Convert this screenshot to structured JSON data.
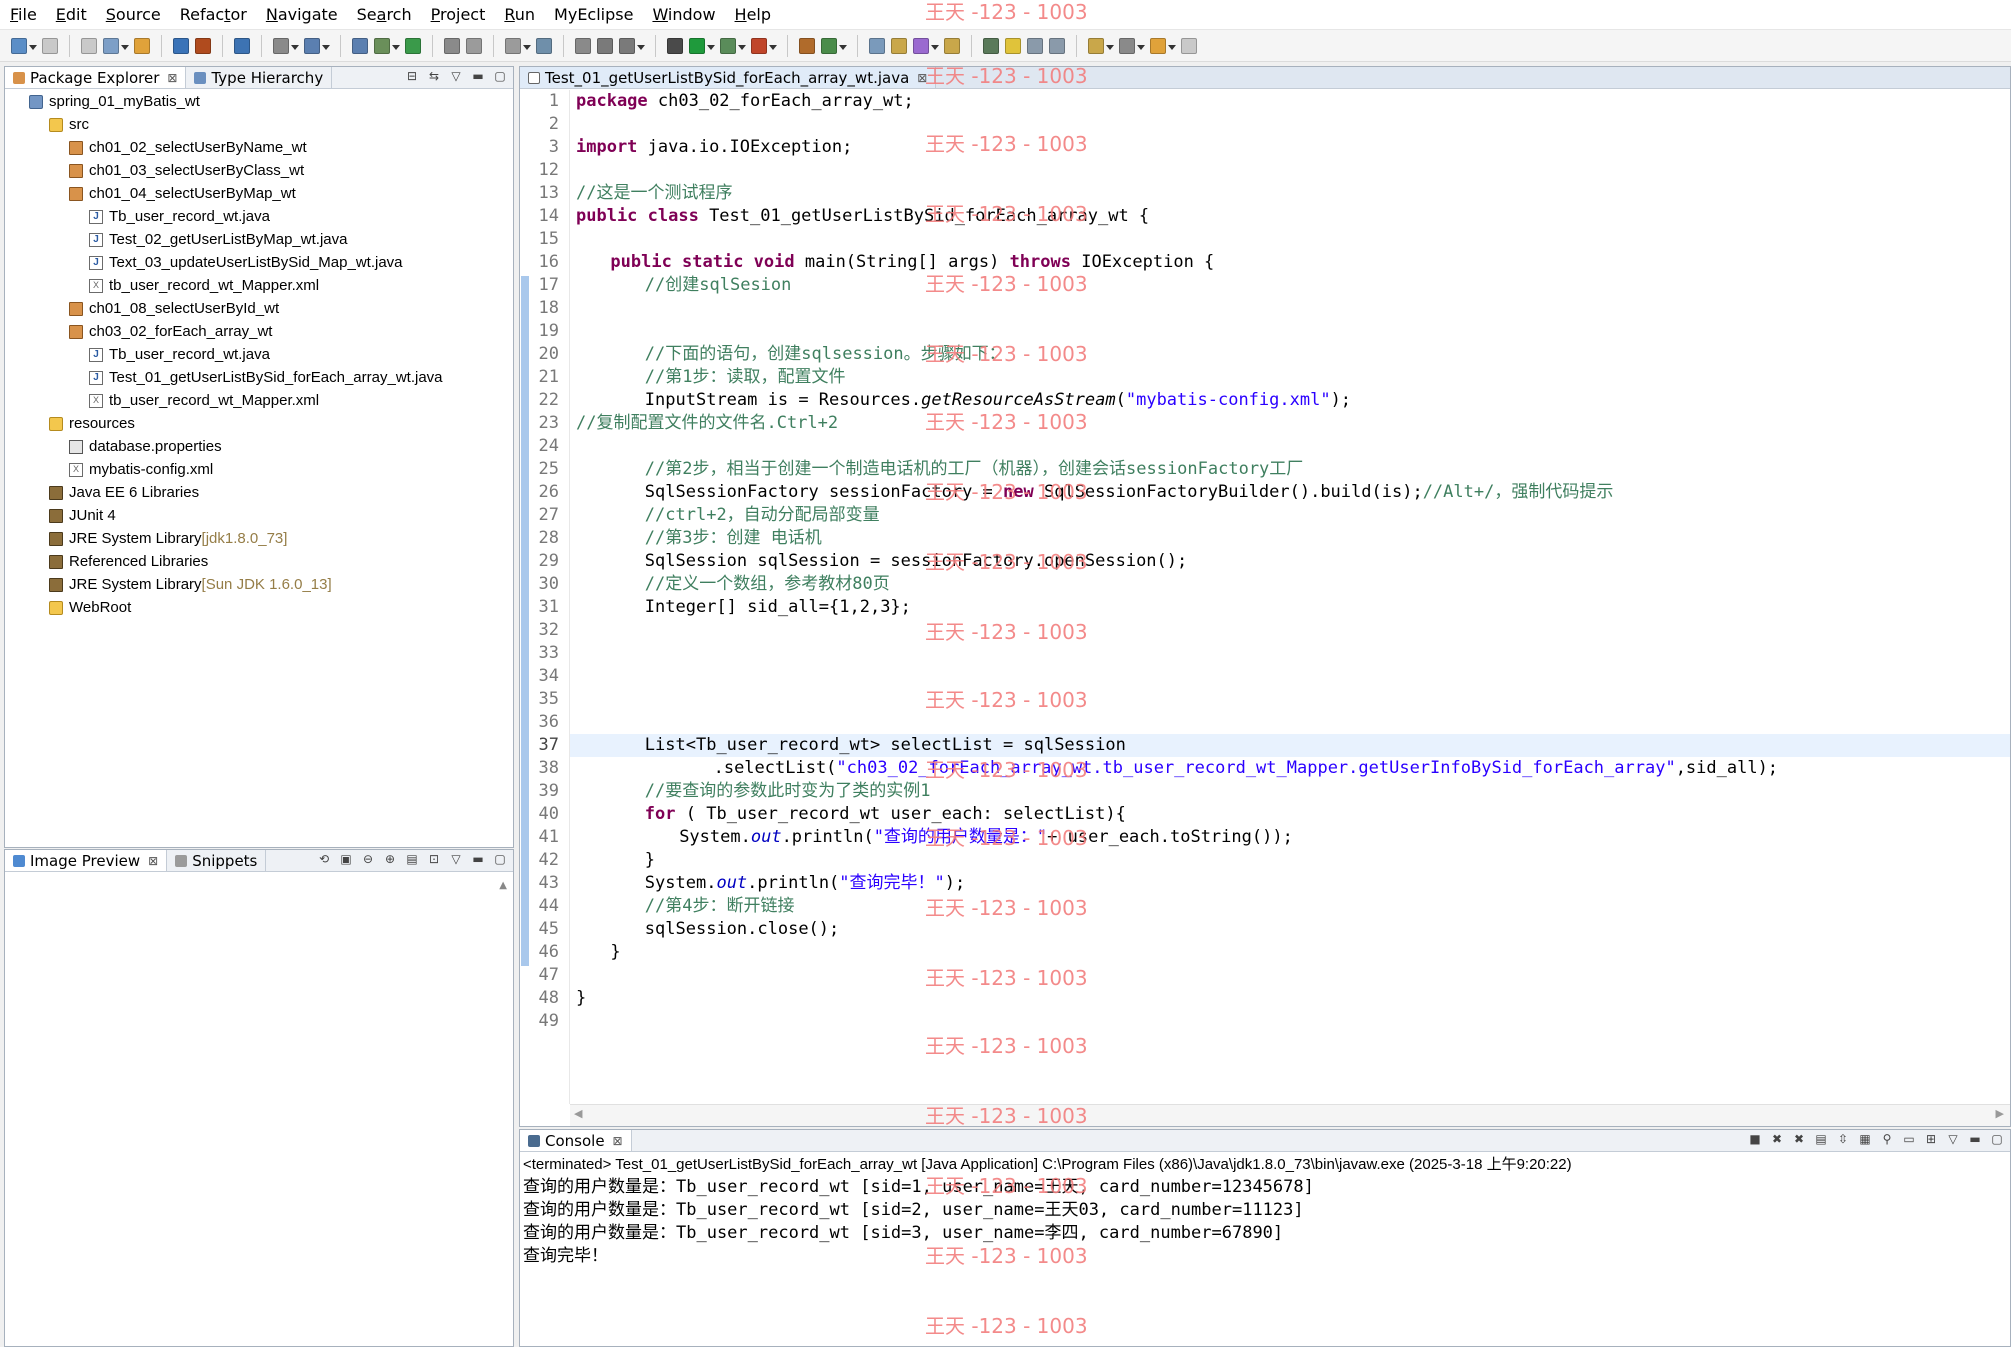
{
  "menu": [
    {
      "mnemonic": "F",
      "rest": "ile"
    },
    {
      "mnemonic": "E",
      "rest": "dit"
    },
    {
      "mnemonic": "S",
      "rest": "ource"
    },
    {
      "mnemonic": "",
      "rest": "Refac",
      "mnem2": "t",
      "rest2": "or"
    },
    {
      "mnemonic": "N",
      "rest": "avigate"
    },
    {
      "mnemonic": "",
      "rest": "Se",
      "mnem2": "a",
      "rest2": "rch"
    },
    {
      "mnemonic": "P",
      "rest": "roject"
    },
    {
      "mnemonic": "R",
      "rest": "un"
    },
    {
      "mnemonic": "",
      "rest": "MyEclipse"
    },
    {
      "mnemonic": "W",
      "rest": "indow"
    },
    {
      "mnemonic": "H",
      "rest": "elp"
    }
  ],
  "package_explorer": {
    "tab_label": "Package Explorer",
    "type_hierarchy_label": "Type Hierarchy",
    "tree": [
      {
        "icon": "project",
        "label": "spring_01_myBatis_wt"
      },
      {
        "icon": "folder",
        "label": "src"
      },
      {
        "icon": "package",
        "label": "ch01_02_selectUserByName_wt"
      },
      {
        "icon": "package",
        "label": "ch01_03_selectUserByClass_wt"
      },
      {
        "icon": "package",
        "label": "ch01_04_selectUserByMap_wt"
      },
      {
        "icon": "java",
        "label": "Tb_user_record_wt.java"
      },
      {
        "icon": "java",
        "label": "Test_02_getUserListByMap_wt.java"
      },
      {
        "icon": "java",
        "label": "Text_03_updateUserListBySid_Map_wt.java"
      },
      {
        "icon": "xml",
        "label": "tb_user_record_wt_Mapper.xml"
      },
      {
        "icon": "package",
        "label": "ch01_08_selectUserById_wt"
      },
      {
        "icon": "package",
        "label": "ch03_02_forEach_array_wt"
      },
      {
        "icon": "java",
        "label": "Tb_user_record_wt.java"
      },
      {
        "icon": "java",
        "label": "Test_01_getUserListBySid_forEach_array_wt.java"
      },
      {
        "icon": "xml",
        "label": "tb_user_record_wt_Mapper.xml"
      },
      {
        "icon": "folder",
        "label": "resources"
      },
      {
        "icon": "props",
        "label": "database.properties"
      },
      {
        "icon": "xml",
        "label": "mybatis-config.xml"
      },
      {
        "icon": "library",
        "label": "Java EE 6 Libraries"
      },
      {
        "icon": "library",
        "label": "JUnit 4"
      },
      {
        "icon": "library",
        "label": "JRE System Library",
        "decoration": "[jdk1.8.0_73]"
      },
      {
        "icon": "library",
        "label": "Referenced Libraries"
      },
      {
        "icon": "library",
        "label": "JRE System Library",
        "decoration": "[Sun JDK 1.6.0_13]"
      },
      {
        "icon": "folder",
        "label": "WebRoot"
      }
    ]
  },
  "image_preview": {
    "tab_label": "Image Preview",
    "snippets_label": "Snippets"
  },
  "editor": {
    "tab_label": "Test_01_getUserListBySid_forEach_array_wt.java",
    "line_numbers": [
      "1",
      "2",
      "3",
      "12",
      "13",
      "14",
      "15",
      "16",
      "17",
      "18",
      "19",
      "20",
      "21",
      "22",
      "23",
      "24",
      "25",
      "26",
      "27",
      "28",
      "29",
      "30",
      "31",
      "32",
      "33",
      "34",
      "35",
      "36",
      "37",
      "38",
      "39",
      "40",
      "41",
      "42",
      "43",
      "44",
      "45",
      "46",
      "47",
      "48",
      "49"
    ],
    "code": {
      "l1_kw": "package",
      "l1_rest": " ch03_02_forEach_array_wt;",
      "l3_kw": "import",
      "l3_rest": " java.io.IOException;",
      "l13": "//这是一个测试程序",
      "l14_kw": "public class",
      "l14_rest": " Test_01_getUserListBySid_forEach_array_wt {",
      "l16_kw1": "public static void",
      "l16_mid": " main(String[] args) ",
      "l16_kw2": "throws",
      "l16_rest": " IOException {",
      "l17": "//创建sqlSesion",
      "l20": "//下面的语句，创建sqlsession。步骤如下：",
      "l21": "//第1步：读取，配置文件",
      "l22_a": "InputStream is = Resources.",
      "l22_m": "getResourceAsStream",
      "l22_b": "(",
      "l22_s": "\"mybatis-config.xml\"",
      "l22_c": ");",
      "l23": "//复制配置文件的文件名.Ctrl+2",
      "l25": "//第2步，相当于创建一个制造电话机的工厂（机器），创建会话sessionFactory工厂",
      "l26_a": "SqlSessionFactory sessionFactory = ",
      "l26_kw": "new",
      "l26_b": " SqlSessionFactoryBuilder().build(is);",
      "l26_c": "//Alt+/，强制代码提示",
      "l27": "//ctrl+2，自动分配局部变量",
      "l28": "//第3步：创建 电话机",
      "l29": "SqlSession sqlSession = sessionFactory.openSession();",
      "l30": "//定义一个数组，参考教材80页",
      "l31": "Integer[] sid_all={1,2,3};",
      "l37": "List<Tb_user_record_wt> selectList = sqlSession",
      "l38_a": ".selectList(",
      "l38_s": "\"ch03_02_forEach_array_wt.tb_user_record_wt_Mapper.getUserInfoBySid_forEach_array\"",
      "l38_b": ",sid_all);",
      "l39": "//要查询的参数此时变为了类的实例1",
      "l40_kw": "for",
      "l40_rest": " ( Tb_user_record_wt user_each: selectList){",
      "l41_a": "System.",
      "l41_f": "out",
      "l41_b": ".println(",
      "l41_s": "\"查询的用户数量是：\"",
      "l41_c": "+ user_each.toString());",
      "l42": "}",
      "l43_a": "System.",
      "l43_f": "out",
      "l43_b": ".println(",
      "l43_s": "\"查询完毕！\"",
      "l43_c": ");",
      "l44": "//第4步：断开链接",
      "l45": "sqlSession.close();",
      "l46": "}",
      "l48": "}"
    }
  },
  "console": {
    "tab_label": "Console",
    "terminated": "<terminated> Test_01_getUserListBySid_forEach_array_wt [Java Application] C:\\Program Files (x86)\\Java\\jdk1.8.0_73\\bin\\javaw.exe (2025-3-18 上午9:20:22)",
    "lines": [
      "查询的用户数量是：Tb_user_record_wt [sid=1, user_name=王天, card_number=12345678]",
      "查询的用户数量是：Tb_user_record_wt [sid=2, user_name=王天03, card_number=11123]",
      "查询的用户数量是：Tb_user_record_wt [sid=3, user_name=李四, card_number=67890]",
      "查询完毕！"
    ]
  },
  "watermark": "王天 -123 - 1003",
  "colors": {
    "keyword": "#7f0055",
    "comment": "#3f7f5f",
    "string": "#2a00ff",
    "field": "#0000c0",
    "watermark": "#f27e7e"
  }
}
